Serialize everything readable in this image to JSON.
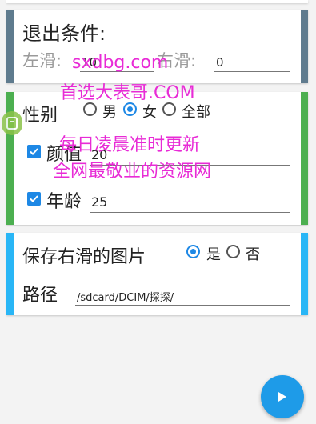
{
  "exit_card": {
    "title": "退出条件:",
    "left_swipe_label": "左滑:",
    "left_swipe_value": "10",
    "right_swipe_label": "右滑:",
    "right_swipe_value": "0",
    "accent_color": "#5f7b8e"
  },
  "filter_card": {
    "gender_label": "性别",
    "gender_options": [
      "男",
      "女",
      "全部"
    ],
    "gender_selected": "女",
    "face_checkbox_checked": true,
    "face_label": "颜值",
    "face_value": "20",
    "age_checkbox_checked": true,
    "age_label": "年龄",
    "age_value": "25",
    "accent_color": "#4caf50"
  },
  "save_card": {
    "save_label": "保存右滑的图片",
    "options": [
      "是",
      "否"
    ],
    "selected": "是",
    "path_label": "路径",
    "path_value": "/sdcard/DCIM/探探/",
    "accent_color": "#29b6f6"
  },
  "watermark": {
    "line1": "sxdbg.com",
    "line2": "首选大表哥.COM",
    "line3": "每日凌晨准时更新",
    "line4": "全网最敬业的资源网"
  },
  "fab": {
    "icon": "play-icon",
    "color": "#1e9be8"
  }
}
